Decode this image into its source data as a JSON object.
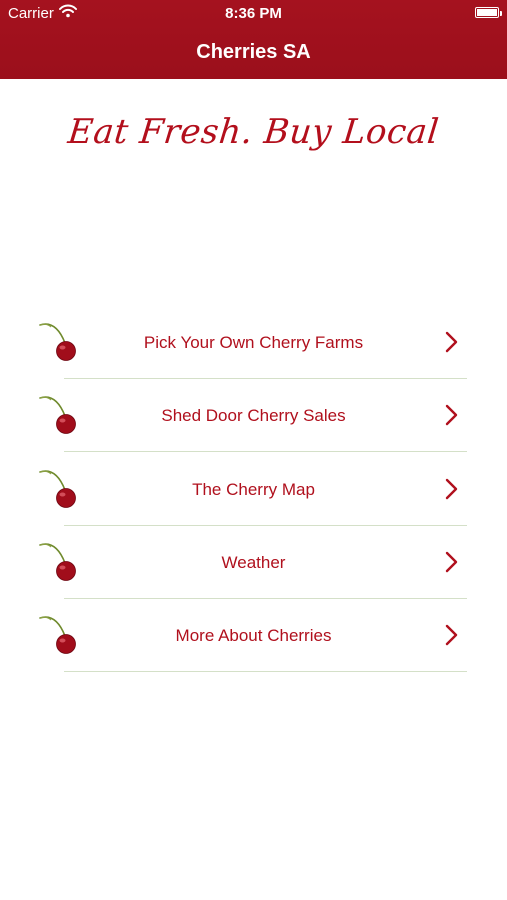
{
  "status_bar": {
    "carrier": "Carrier",
    "time": "8:36 PM"
  },
  "nav": {
    "title": "Cherries SA"
  },
  "tagline": "Eat Fresh. Buy Local",
  "menu": {
    "items": [
      {
        "label": "Pick Your Own Cherry Farms",
        "icon": "cherry-icon"
      },
      {
        "label": "Shed Door Cherry Sales",
        "icon": "cherry-icon"
      },
      {
        "label": "The Cherry Map",
        "icon": "cherry-icon"
      },
      {
        "label": "Weather",
        "icon": "cherry-icon"
      },
      {
        "label": "More About Cherries",
        "icon": "cherry-icon"
      }
    ]
  },
  "colors": {
    "brand_red": "#a5121f",
    "label_red": "#b0101d",
    "divider": "#d4e0c8"
  }
}
